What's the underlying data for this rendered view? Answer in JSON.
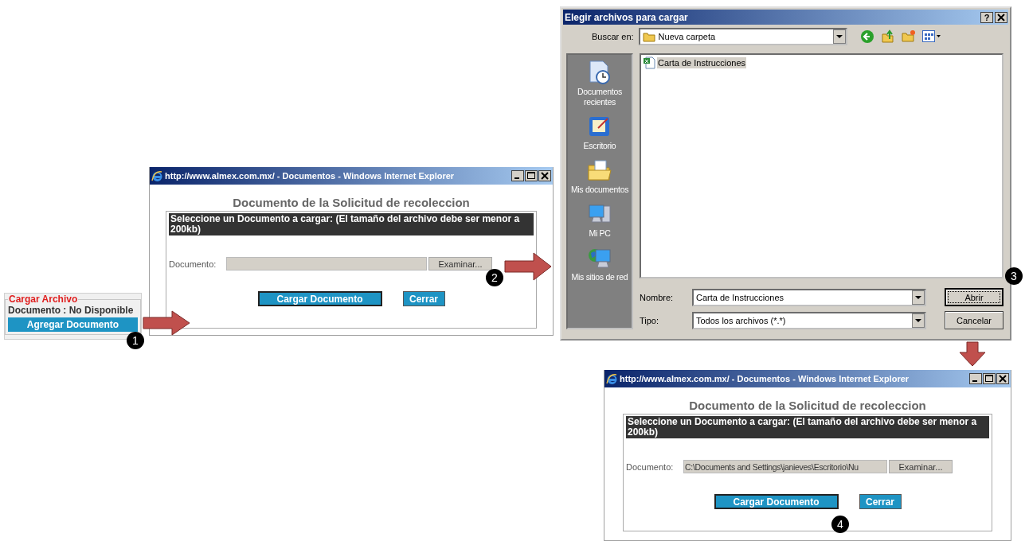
{
  "cargar_archivo": {
    "legend": "Cargar Archivo",
    "status": "Documento : No Disponible",
    "button": "Agregar Documento"
  },
  "browser_windows": [
    {
      "title": "http://www.almex.com.mx/ - Documentos - Windows Internet Explorer",
      "heading": "Documento de la Solicitud de recoleccion",
      "instruction": "Seleccione un Documento a cargar: (El tamaño del archivo debe ser menor a 200kb)",
      "field_label": "Documento:",
      "browse_button": "Examinar...",
      "buttons": [
        "Cargar Documento",
        "Cerrar"
      ]
    },
    {
      "title": "http://www.almex.com.mx/ - Documentos - Windows Internet Explorer",
      "heading": "Documento de la Solicitud de recoleccion",
      "instruction": "Seleccione un Documento a cargar: (El tamaño del archivo debe ser menor a 200kb)",
      "field_label": "Documento:",
      "field_value": "C:\\Documents and Settings\\janieves\\Escritorio\\Nu",
      "browse_button": "Examinar...",
      "buttons": [
        "Cargar Documento",
        "Cerrar"
      ]
    }
  ],
  "file_dialog": {
    "title": "Elegir archivos para cargar",
    "help_button": "?",
    "look_in_label": "Buscar en:",
    "look_in_value": "Nueva carpeta",
    "places": [
      {
        "kind": "recent",
        "label": "Documentos recientes"
      },
      {
        "kind": "desktop",
        "label": "Escritorio"
      },
      {
        "kind": "documents",
        "label": "Mis documentos"
      },
      {
        "kind": "computer",
        "label": "Mi PC"
      },
      {
        "kind": "network",
        "label": "Mis sitios de red"
      }
    ],
    "files": [
      {
        "name": "Carta de Instrucciones",
        "selected": true
      }
    ],
    "name_label": "Nombre:",
    "name_value": "Carta de Instrucciones",
    "type_label": "Tipo:",
    "type_value": "Todos los archivos (*.*)",
    "buttons": [
      "Abrir",
      "Cancelar"
    ]
  },
  "steps": [
    {
      "label": "1"
    },
    {
      "label": "2"
    },
    {
      "label": "3"
    },
    {
      "label": "4"
    }
  ]
}
